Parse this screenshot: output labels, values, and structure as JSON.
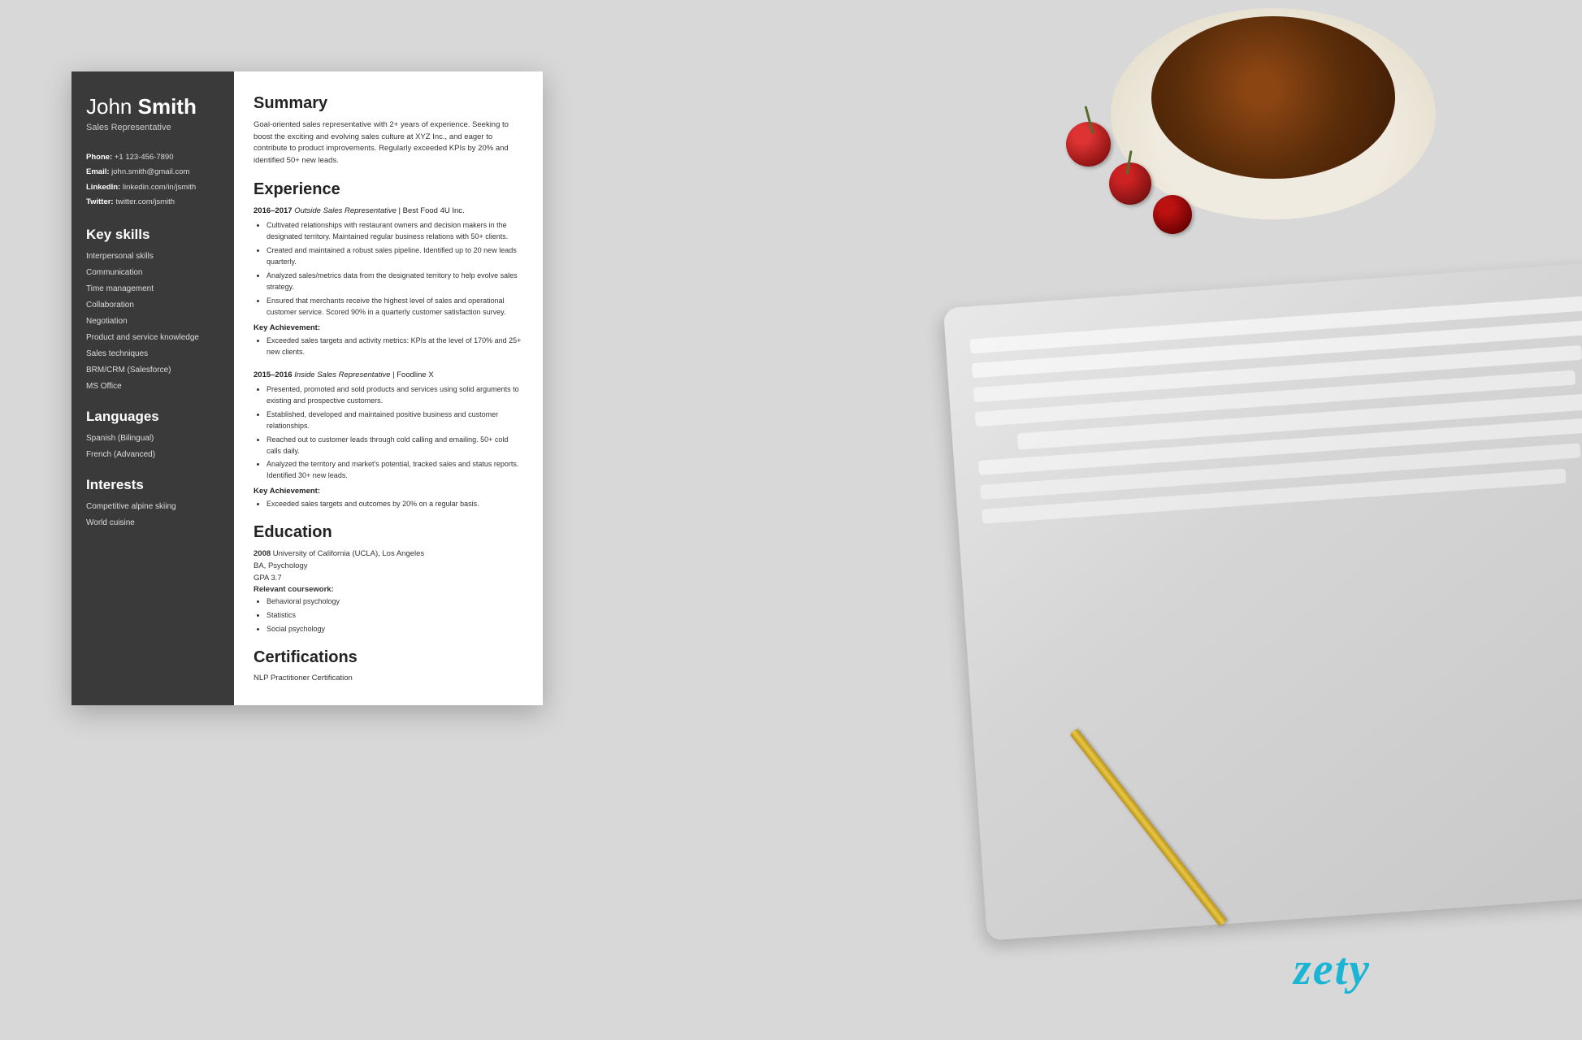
{
  "background": {
    "color": "#d4d4d4"
  },
  "branding": {
    "logo": "zety",
    "logo_color": "#1ab5d4"
  },
  "resume": {
    "sidebar": {
      "first_name": "John",
      "last_name": "Smith",
      "job_title": "Sales Representative",
      "contact": {
        "phone_label": "Phone:",
        "phone_value": "+1 123-456-7890",
        "email_label": "Email:",
        "email_value": "john.smith@gmail.com",
        "linkedin_label": "LinkedIn:",
        "linkedin_value": "linkedin.com/in/jsmith",
        "twitter_label": "Twitter:",
        "twitter_value": "twitter.com/jsmith"
      },
      "key_skills_title": "Key skills",
      "skills": [
        "Interpersonal skills",
        "Communication",
        "Time management",
        "Collaboration",
        "Negotiation",
        "Product and service knowledge",
        "Sales techniques",
        "BRM/CRM (Salesforce)",
        "MS Office"
      ],
      "languages_title": "Languages",
      "languages": [
        "Spanish (Bilingual)",
        "French (Advanced)"
      ],
      "interests_title": "Interests",
      "interests": [
        "Competitive alpine skiing",
        "World cuisine"
      ]
    },
    "main": {
      "summary_title": "Summary",
      "summary_text": "Goal-oriented sales representative with 2+ years of experience. Seeking to boost the exciting and evolving sales culture at XYZ Inc., and eager to contribute to product improvements. Regularly exceeded KPIs by 20% and identified 50+ new leads.",
      "experience_title": "Experience",
      "experience": [
        {
          "years": "2016–2017",
          "job_title": "Outside Sales Representative",
          "company": "Best Food 4U Inc.",
          "bullets": [
            "Cultivated relationships with restaurant owners and decision makers in the designated territory. Maintained regular business relations with 50+ clients.",
            "Created and maintained a robust sales pipeline. Identified up to 20 new leads quarterly.",
            "Analyzed sales/metrics data from the designated territory to help evolve sales strategy.",
            "Ensured that merchants receive the highest level of sales and operational customer service. Scored 90% in a quarterly customer satisfaction survey."
          ],
          "key_achievement_label": "Key Achievement:",
          "key_achievement": "Exceeded sales targets and activity metrics: KPIs at the level of 170% and 25+ new clients."
        },
        {
          "years": "2015–2016",
          "job_title": "Inside Sales Representative",
          "company": "Foodline X",
          "bullets": [
            "Presented, promoted and sold products and services using solid arguments to existing and prospective customers.",
            "Established, developed and maintained positive business and customer relationships.",
            "Reached out to customer leads through cold calling and emailing. 50+ cold calls daily.",
            "Analyzed the territory and market's potential, tracked sales and status reports. Identified 30+ new leads."
          ],
          "key_achievement_label": "Key Achievement:",
          "key_achievement": "Exceeded sales targets and outcomes by 20% on a regular basis."
        }
      ],
      "education_title": "Education",
      "education": [
        {
          "year": "2008",
          "institution": "University of California (UCLA), Los Angeles",
          "degree": "BA, Psychology",
          "gpa": "GPA 3.7",
          "coursework_label": "Relevant coursework:",
          "coursework": [
            "Behavioral psychology",
            "Statistics",
            "Social psychology"
          ]
        }
      ],
      "certifications_title": "Certifications",
      "certifications": [
        "NLP Practitioner Certification"
      ]
    }
  }
}
